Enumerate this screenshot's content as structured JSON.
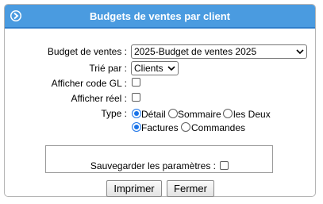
{
  "header": {
    "title": "Budgets de ventes par client",
    "icon": "circle-arrow-right-icon"
  },
  "form": {
    "budget": {
      "label": "Budget de ventes :",
      "selected": "2025-Budget de ventes 2025"
    },
    "sort": {
      "label": "Trié par :",
      "selected": "Clients"
    },
    "show_gl": {
      "label": "Afficher code GL :",
      "checked": false
    },
    "show_actual": {
      "label": "Afficher réel :",
      "checked": false
    },
    "type": {
      "label": "Type :",
      "options_row1": [
        "Détail",
        "Sommaire",
        "les Deux"
      ],
      "selected_row1": "Détail",
      "options_row2": [
        "Factures",
        "Commandes"
      ],
      "selected_row2": "Factures"
    },
    "save_params": {
      "label": "Sauvegarder les paramètres :",
      "checked": false
    }
  },
  "buttons": {
    "print": "Imprimer",
    "close": "Fermer"
  },
  "colors": {
    "title_bar": "#4a9be0",
    "accent": "#1a73e8"
  }
}
